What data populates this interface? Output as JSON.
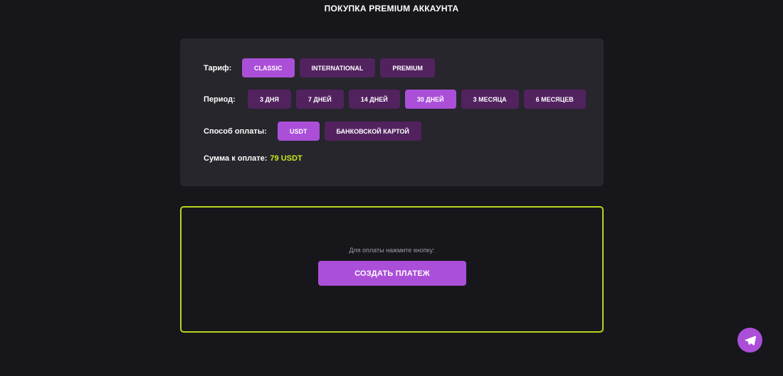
{
  "header": {
    "title": "ПОКУПКА PREMIUM АККАУНТА"
  },
  "options": {
    "tariff": {
      "label": "Тариф:",
      "items": [
        {
          "label": "CLASSIC",
          "active": true
        },
        {
          "label": "INTERNATIONAL",
          "active": false
        },
        {
          "label": "PREMIUM",
          "active": false
        }
      ]
    },
    "period": {
      "label": "Период:",
      "items": [
        {
          "label": "3 ДНЯ",
          "active": false
        },
        {
          "label": "7 ДНЕЙ",
          "active": false
        },
        {
          "label": "14 ДНЕЙ",
          "active": false
        },
        {
          "label": "30 ДНЕЙ",
          "active": true
        },
        {
          "label": "3 МЕСЯЦА",
          "active": false
        },
        {
          "label": "6 МЕСЯЦЕВ",
          "active": false
        }
      ]
    },
    "payment": {
      "label": "Способ оплаты:",
      "items": [
        {
          "label": "USDT",
          "active": true
        },
        {
          "label": "БАНКОВСКОЙ КАРТОЙ",
          "active": false
        }
      ]
    },
    "sum": {
      "label": "Сумма к оплате:",
      "value": "79 USDT"
    }
  },
  "payment_box": {
    "hint": "Для оплаты нажмите кнопку:",
    "button_label": "СОЗДАТЬ ПЛАТЕЖ"
  },
  "floating": {
    "icon": "telegram-icon"
  },
  "colors": {
    "background": "#17171b",
    "card": "#26262c",
    "chip": "#52225f",
    "accent": "#ab4fd9",
    "highlight": "#c6e81c"
  }
}
